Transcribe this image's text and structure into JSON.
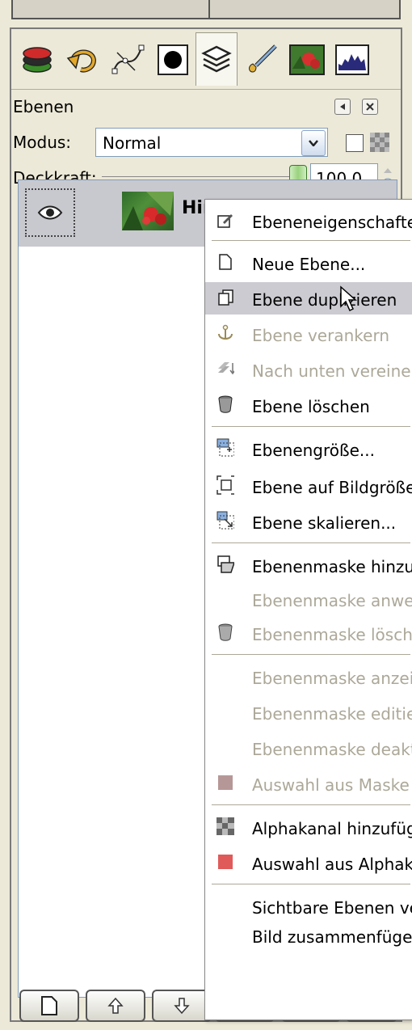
{
  "panel": {
    "title": "Ebenen",
    "mode_label": "Modus:",
    "mode_value": "Normal",
    "opacity_label": "Deckkraft:",
    "opacity_value": "100,0",
    "opacity_fraction": 1.0
  },
  "tabs": [
    {
      "name": "tab-layers-stack",
      "icon": "layers-stack-icon"
    },
    {
      "name": "tab-undo-history",
      "icon": "undo-history-icon"
    },
    {
      "name": "tab-paths",
      "icon": "paths-icon"
    },
    {
      "name": "tab-channels",
      "icon": "channels-icon"
    },
    {
      "name": "tab-layers",
      "icon": "layers-icon",
      "active": true
    },
    {
      "name": "tab-brushes",
      "icon": "brush-icon"
    },
    {
      "name": "tab-image",
      "icon": "image-icon"
    },
    {
      "name": "tab-histogram",
      "icon": "histogram-icon"
    }
  ],
  "layer": {
    "name": "Hin",
    "visible_icon": "eye-icon"
  },
  "menu": {
    "items": [
      {
        "label": "Ebeneneigenschaften",
        "icon": "edit-properties-icon",
        "disabled": false
      },
      {
        "label": "Neue Ebene...",
        "icon": "new-layer-icon",
        "disabled": false
      },
      {
        "label": "Ebene duplizieren",
        "icon": "duplicate-icon",
        "disabled": false,
        "highlighted": true
      },
      {
        "label": "Ebene verankern",
        "icon": "anchor-icon",
        "disabled": true
      },
      {
        "label": "Nach unten vereinen",
        "icon": "merge-down-icon",
        "disabled": true
      },
      {
        "label": "Ebene löschen",
        "icon": "delete-icon",
        "disabled": false
      },
      {
        "label": "Ebenengröße...",
        "icon": "layer-size-icon",
        "disabled": false
      },
      {
        "label": "Ebene auf Bildgröße",
        "icon": "layer-to-image-size-icon",
        "disabled": false
      },
      {
        "label": "Ebene skalieren...",
        "icon": "scale-layer-icon",
        "disabled": false
      },
      {
        "label": "Ebenenmaske hinzufü",
        "icon": "add-mask-icon",
        "disabled": false
      },
      {
        "label": "Ebenenmaske anwend",
        "icon": "",
        "disabled": true
      },
      {
        "label": "Ebenenmaske löschen",
        "icon": "delete-mask-icon",
        "disabled": true
      },
      {
        "label": "Ebenenmaske anzeige",
        "icon": "",
        "disabled": true
      },
      {
        "label": "Ebenenmaske editiere",
        "icon": "",
        "disabled": true
      },
      {
        "label": "Ebenenmaske deaktiv",
        "icon": "",
        "disabled": true
      },
      {
        "label": "Auswahl aus Maske",
        "icon": "mask-selection-icon",
        "disabled": true
      },
      {
        "label": "Alphakanal hinzufüger",
        "icon": "alpha-channel-icon",
        "disabled": false
      },
      {
        "label": "Auswahl aus Alphakar",
        "icon": "alpha-selection-icon",
        "disabled": false
      },
      {
        "label": "Sichtbare Ebenen ver",
        "icon": "",
        "disabled": false
      },
      {
        "label": "Bild zusammenfügen",
        "icon": "",
        "disabled": false
      }
    ]
  },
  "bottom_buttons": [
    {
      "name": "new-layer-button",
      "icon": "new-layer-icon"
    },
    {
      "name": "raise-layer-button",
      "icon": "arrow-up-icon"
    },
    {
      "name": "lower-layer-button",
      "icon": "arrow-down-icon"
    },
    {
      "name": "duplicate-layer-button",
      "icon": "duplicate-icon"
    },
    {
      "name": "anchor-layer-button",
      "icon": "anchor-icon"
    },
    {
      "name": "delete-layer-button",
      "icon": "delete-icon"
    }
  ],
  "colors": {
    "menu_highlight": "#cbcbd1",
    "disabled_text": "#aca899",
    "layer_row": "#c8c8cf"
  }
}
